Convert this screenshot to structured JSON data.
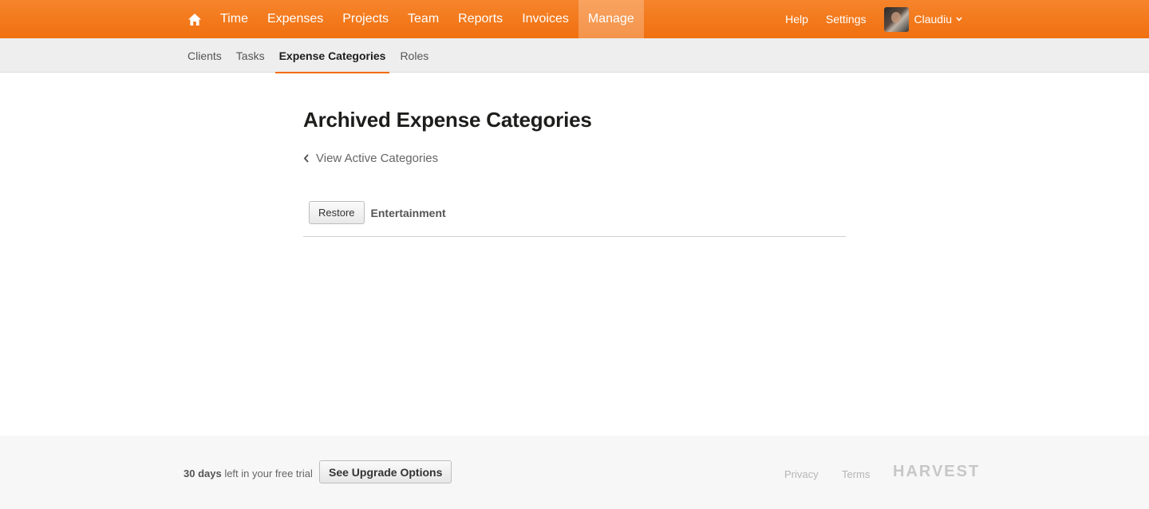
{
  "nav": {
    "items": [
      {
        "label": "Time",
        "active": false
      },
      {
        "label": "Expenses",
        "active": false
      },
      {
        "label": "Projects",
        "active": false
      },
      {
        "label": "Team",
        "active": false
      },
      {
        "label": "Reports",
        "active": false
      },
      {
        "label": "Invoices",
        "active": false
      },
      {
        "label": "Manage",
        "active": true
      }
    ],
    "help": "Help",
    "settings": "Settings",
    "user": "Claudiu"
  },
  "subnav": {
    "items": [
      {
        "label": "Clients",
        "active": false
      },
      {
        "label": "Tasks",
        "active": false
      },
      {
        "label": "Expense Categories",
        "active": true
      },
      {
        "label": "Roles",
        "active": false
      }
    ]
  },
  "main": {
    "title": "Archived Expense Categories",
    "back_link": "View Active Categories",
    "rows": [
      {
        "button": "Restore",
        "name": "Entertainment"
      }
    ]
  },
  "footer": {
    "trial_days": "30 days",
    "trial_rest": " left in your free trial",
    "upgrade": "See Upgrade Options",
    "privacy": "Privacy",
    "terms": "Terms",
    "logo": "HARVEST"
  },
  "colors": {
    "accent": "#f36c00",
    "nav_bg": "#f0700f"
  }
}
